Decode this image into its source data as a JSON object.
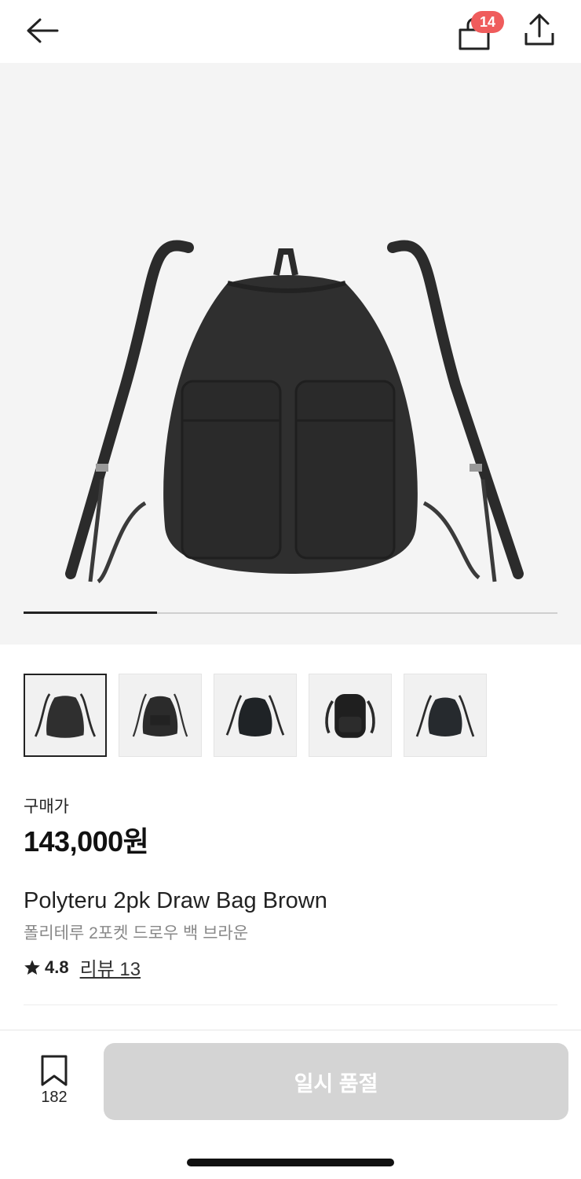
{
  "header": {
    "cart_count": "14"
  },
  "gallery": {
    "progress_fraction": 0.25
  },
  "thumbnails": [
    {
      "label": "thumbnail-1",
      "active": true
    },
    {
      "label": "thumbnail-2",
      "active": false
    },
    {
      "label": "thumbnail-3",
      "active": false
    },
    {
      "label": "thumbnail-4",
      "active": false
    },
    {
      "label": "thumbnail-5",
      "active": false
    }
  ],
  "product": {
    "price_label": "구매가",
    "price": "143,000원",
    "name_en": "Polyteru 2pk Draw Bag Brown",
    "name_ko": "폴리테루 2포켓 드로우 백 브라운",
    "rating": "4.8",
    "review_label": "리뷰 13"
  },
  "bottom": {
    "bookmark_count": "182",
    "buy_label": "일시 품절"
  },
  "colors": {
    "badge": "#ef5c5c",
    "disabled_button": "#d4d4d4",
    "gallery_bg": "#f4f4f4"
  }
}
